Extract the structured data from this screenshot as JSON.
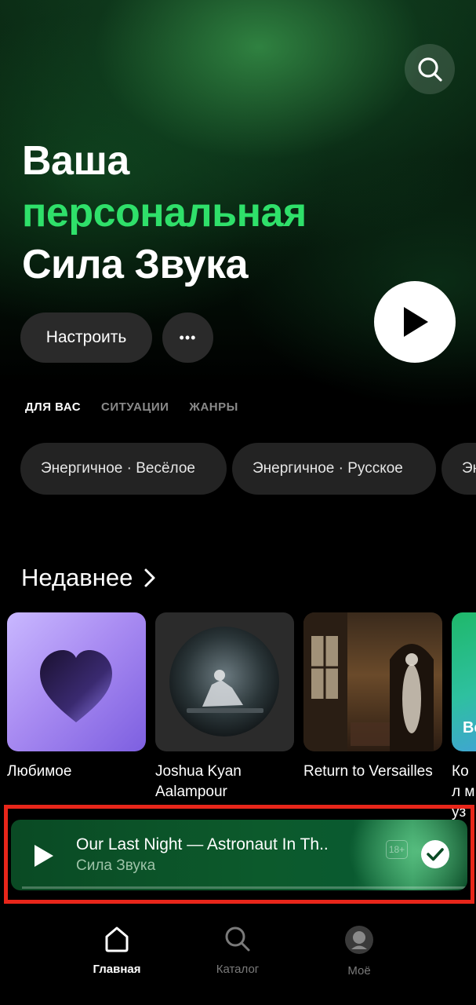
{
  "header": {
    "line1": "Ваша",
    "line2": "персональная",
    "line3": "Сила Звука"
  },
  "actions": {
    "customize_label": "Настроить",
    "more_label": "•••"
  },
  "tabs": [
    {
      "label": "ДЛЯ ВАС",
      "active": true
    },
    {
      "label": "СИТУАЦИИ",
      "active": false
    },
    {
      "label": "ЖАНРЫ",
      "active": false
    }
  ],
  "chips": [
    "Энергичное · Весёлое",
    "Энергичное · Русское",
    "Эн"
  ],
  "recent": {
    "title": "Недавнее",
    "items": [
      {
        "label": "Любимое"
      },
      {
        "label": "Joshua Kyan Aalampour"
      },
      {
        "label": "Return to Versailles"
      },
      {
        "label": "Кол муз"
      },
      {
        "cover_text": "Ве"
      }
    ]
  },
  "player": {
    "title": "Our Last Night — Astronaut In Th..",
    "artist": "Сила Звука",
    "age_badge": "18+"
  },
  "nav": [
    {
      "label": "Главная",
      "icon": "home-icon",
      "active": true
    },
    {
      "label": "Каталог",
      "icon": "search-icon",
      "active": false
    },
    {
      "label": "Моё",
      "icon": "avatar",
      "active": false
    }
  ],
  "colors": {
    "accent_green": "#2fe06a",
    "player_green": "#0c5a2c",
    "highlight_red": "#e8261a"
  }
}
